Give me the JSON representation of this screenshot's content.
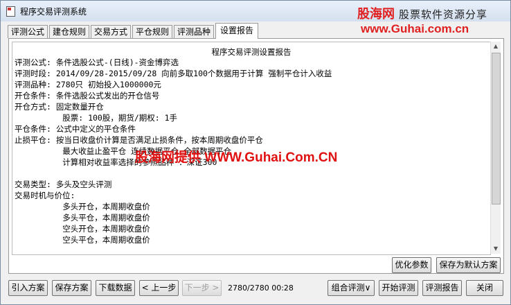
{
  "window": {
    "title": "程序交易评测系统"
  },
  "watermark": {
    "name": "股海网",
    "slogan": "股票软件资源分享",
    "url": "www.Guhai.com.cn"
  },
  "tabs": [
    {
      "label": "评测公式"
    },
    {
      "label": "建仓规则"
    },
    {
      "label": "交易方式"
    },
    {
      "label": "平仓规则"
    },
    {
      "label": "评测品种"
    },
    {
      "label": "设置报告",
      "active": true
    }
  ],
  "report": {
    "title": "程序交易评测设置报告",
    "lines": [
      "评测公式: 条件选股公式-(日线)-资金博弈选",
      "评测时段: 2014/09/28-2015/09/28 向前多取100个数据用于计算 强制平仓计入收益",
      "评测品种: 2780只 初始投入1000000元",
      "开仓条件: 条件选股公式发出的开仓信号",
      "开仓方式: 固定数量开仓",
      "          股票: 100股，期货/期权: 1手",
      "平仓条件: 公式中定义的平仓条件",
      "止损平仓: 按当日收盘价计算是否满足止损条件，按本周期收盘价平仓",
      "          最大收益止盈平仓 连续数据平仓 全部数据平仓",
      "          计算相对收益率选择的参照品种 ：深证300",
      "",
      "交易类型: 多头及空头评测",
      "交易时机与价位:",
      "          多头开仓，本周期收盘价",
      "          多头平仓，本周期收盘价",
      "          空头开仓，本周期收盘价",
      "          空头平仓，本周期收盘价"
    ],
    "overlay_ad": "股海网提供 WWW.Guhai.Com.CN"
  },
  "panel_buttons": {
    "optimize": "优化参数",
    "save_default": "保存为默认方案"
  },
  "bottom": {
    "import": "引入方案",
    "save": "保存方案",
    "download": "下载数据",
    "prev": "< 上一步",
    "next": "下一步 >",
    "progress": "2780/2780 00:28",
    "combo": "组合评测∨",
    "start": "开始评测",
    "report": "评测报告",
    "close": "关闭"
  }
}
